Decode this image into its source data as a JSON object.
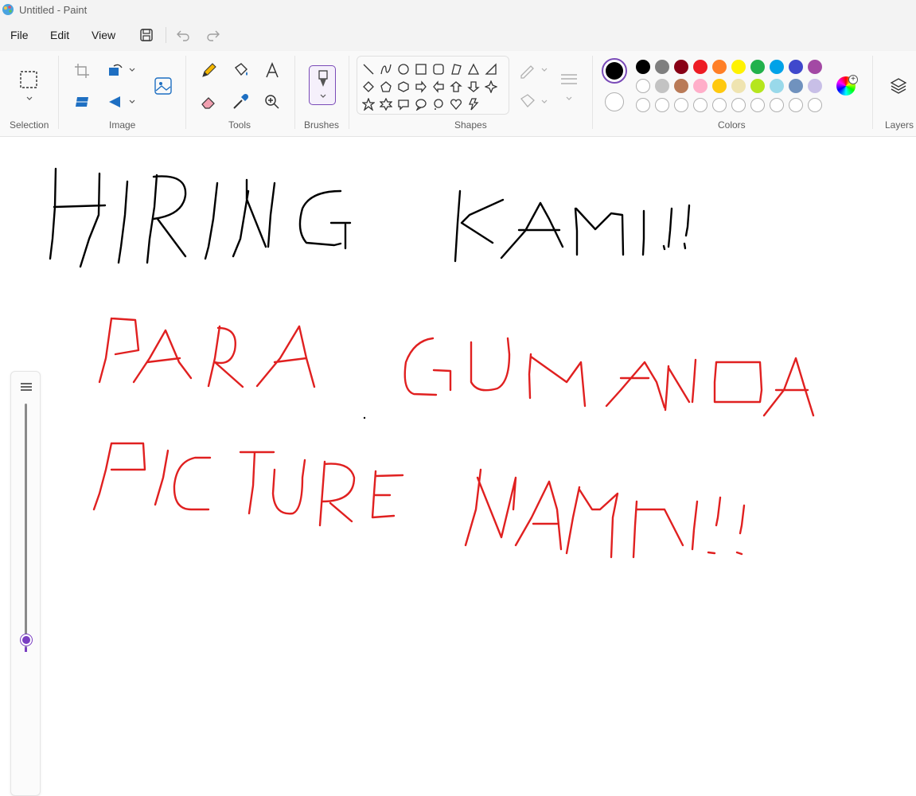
{
  "window": {
    "title": "Untitled - Paint"
  },
  "menu": {
    "file": "File",
    "edit": "Edit",
    "view": "View"
  },
  "groups": {
    "selection": "Selection",
    "image": "Image",
    "tools": "Tools",
    "brushes": "Brushes",
    "shapes": "Shapes",
    "colors": "Colors",
    "layers": "Layers"
  },
  "colors": {
    "accent": "#7a4bb8",
    "primary": "#000000",
    "secondary": "#ffffff",
    "palette_row1": [
      "#000000",
      "#7f7f7f",
      "#880015",
      "#ed1c24",
      "#ff7f27",
      "#fff200",
      "#22b14c",
      "#00a2e8",
      "#3f48cc",
      "#a349a4"
    ],
    "palette_row2": [
      "#ffffff",
      "#c3c3c3",
      "#b97a57",
      "#ffaec9",
      "#ffc90e",
      "#efe4b0",
      "#b5e61d",
      "#99d9ea",
      "#7092be",
      "#c8bfe7"
    ],
    "palette_row3_empty_count": 10
  },
  "canvas": {
    "ink_black": "#000000",
    "ink_red": "#e02020"
  }
}
